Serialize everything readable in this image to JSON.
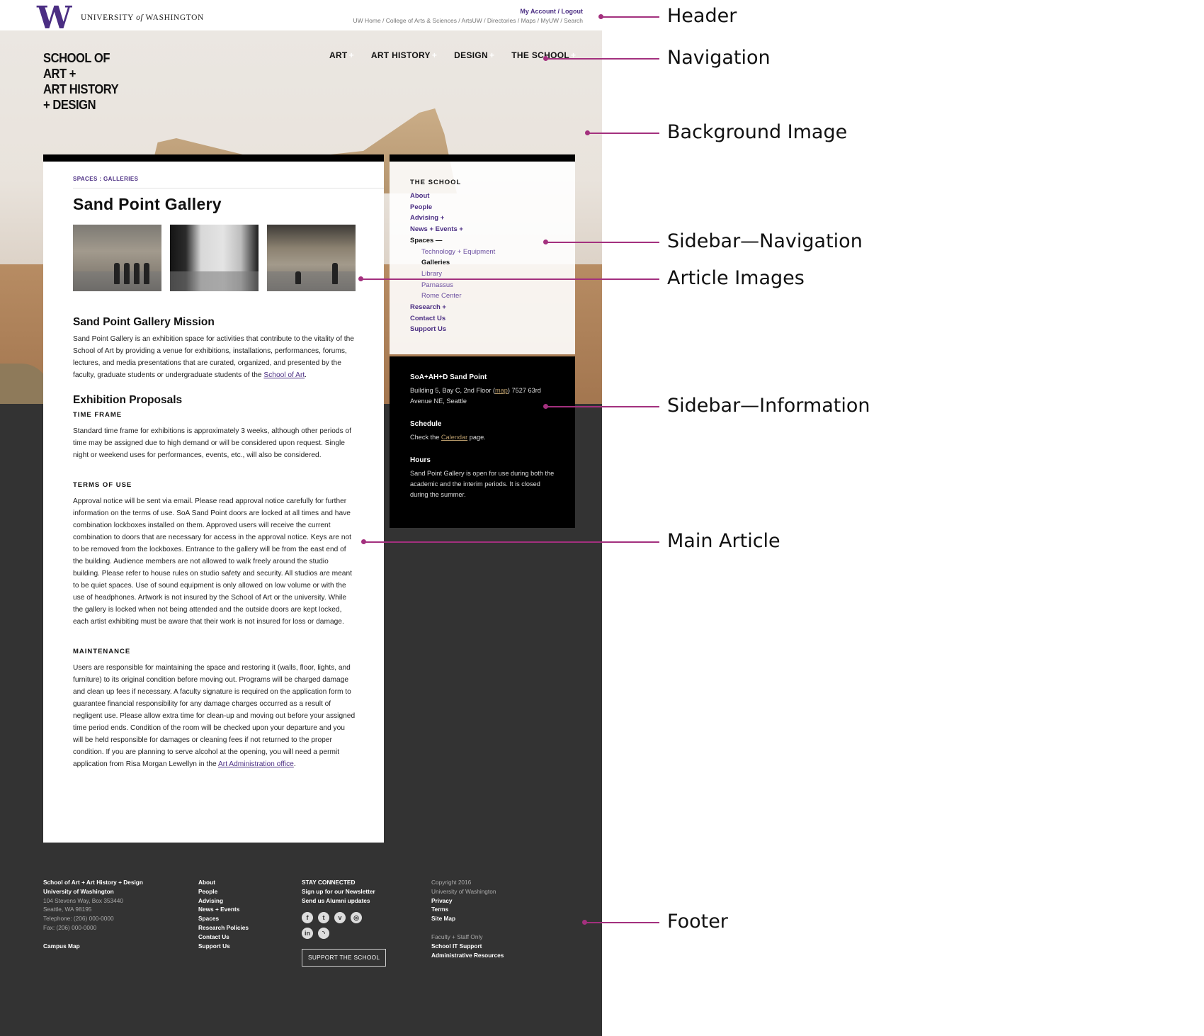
{
  "header": {
    "uw_name": "UNIVERSITY",
    "uw_of": "of",
    "uw_name_end": "WASHINGTON",
    "account": "My Account / Logout",
    "util_links": "UW Home / College of Arts & Sciences / ArtsUW / Directories / Maps / MyUW / Search"
  },
  "logo": {
    "lines": [
      "SCHOOL OF",
      "ART +",
      "ART HISTORY",
      "+ DESIGN"
    ]
  },
  "nav": {
    "items": [
      "ART",
      "ART HISTORY",
      "DESIGN",
      "THE SCHOOL"
    ],
    "plus": "+"
  },
  "article": {
    "breadcrumb": "SPACES : GALLERIES",
    "title": "Sand Point Gallery",
    "mission_heading": "Sand Point Gallery Mission",
    "mission_text": "Sand Point Gallery is an exhibition space for activities that contribute to the vitality of the School of Art by providing a venue for exhibitions, installations, performances, forums, lectures, and media presentations that are curated, organized, and presented by the faculty, graduate students or undergraduate students of the ",
    "mission_link": "School of Art",
    "proposals_heading": "Exhibition Proposals",
    "timeframe_heading": "TIME FRAME",
    "timeframe_text": "Standard time frame for exhibitions is approximately 3 weeks, although other periods of time may be assigned due to high demand or will be considered upon request. Single night or weekend uses for performances, events, etc., will also be considered.",
    "terms_heading": "TERMS OF USE",
    "terms_text": "Approval notice will be sent via email. Please read approval notice carefully for further information on the terms of use. SoA Sand Point doors are locked at all times and have combination lockboxes installed on them. Approved users will receive the current combination to doors that are necessary for access in the approval notice. Keys are not to be removed from the lockboxes. Entrance to the gallery will be from the east end of the building. Audience members are not allowed to walk freely around the studio building. Please refer to house rules on studio safety and security. All studios are meant to be quiet spaces. Use of sound equipment is only allowed on low volume or with the use of headphones. Artwork is not insured by the School of Art or the university. While the gallery is locked when not being attended and the outside doors are kept locked, each artist exhibiting must be aware that their work is not insured for loss or damage.",
    "maintenance_heading": "MAINTENANCE",
    "maintenance_text": "Users are responsible for maintaining the space and restoring it (walls, floor, lights, and furniture) to its original condition before moving out. Programs will be charged damage and clean up fees if necessary. A faculty signature is required on the application form to guarantee financial responsibility for any damage charges occurred as a result of negligent use. Please allow extra time for clean-up and moving out before your assigned time period ends. Condition of the room will be checked upon your departure and you will be held responsible for damages or cleaning fees if not returned to the proper condition. If you are planning to serve alcohol at the opening, you will need a permit application from Risa Morgan Lewellyn in the ",
    "maintenance_link": "Art Administration office"
  },
  "sidebar_nav": {
    "heading": "THE SCHOOL",
    "about": "About",
    "people": "People",
    "advising": "Advising +",
    "news": "News + Events +",
    "spaces": "Spaces —",
    "tech": "Technology + Equipment",
    "galleries": "Galleries",
    "library": "Library",
    "parnassus": "Parnassus",
    "rome": "Rome Center",
    "research": "Research +",
    "contact": "Contact Us",
    "support": "Support Us"
  },
  "sidebar_info": {
    "location_heading": "SoA+AH+D Sand Point",
    "location_pre": "Building 5, Bay C, 2nd Floor (",
    "location_link": "map",
    "location_post": ") 7527 63rd Avenue NE, Seattle",
    "schedule_heading": "Schedule",
    "schedule_pre": "Check the ",
    "schedule_link": "Calendar",
    "schedule_post": " page.",
    "hours_heading": "Hours",
    "hours_text": "Sand Point Gallery is open for use during both the academic and the interim periods. It is closed during the summer."
  },
  "footer": {
    "col1": {
      "school": "School of Art + Art History + Design",
      "uw": "University of Washington",
      "address1": "104 Stevens Way, Box 353440",
      "address2": "Seattle, WA 98195",
      "phone": "Telephone: (206) 000-0000",
      "fax": "Fax: (206) 000-0000",
      "campus_map": "Campus Map"
    },
    "col2": [
      "About",
      "People",
      "Advising",
      "News + Events",
      "Spaces",
      "Research Policies",
      "Contact Us",
      "Support Us"
    ],
    "col3": {
      "heading": "STAY CONNECTED",
      "newsletter": "Sign up for our Newsletter",
      "alumni": "Send us Alumni updates",
      "support_button": "SUPPORT THE SCHOOL",
      "social_icons": [
        "facebook-icon",
        "twitter-icon",
        "vimeo-icon",
        "instagram-icon",
        "linkedin-icon",
        "rss-icon"
      ]
    },
    "col4": {
      "copyright": "Copyright 2016",
      "uw": "University of Washington",
      "privacy": "Privacy",
      "terms": "Terms",
      "sitemap": "Site Map",
      "faculty": "Faculty + Staff Only",
      "it": "School IT Support",
      "admin": "Administrative Resources"
    }
  },
  "annotations": [
    "Header",
    "Navigation",
    "Background Image",
    "Sidebar—Navigation",
    "Article Images",
    "Sidebar—Information",
    "Main Article",
    "Footer"
  ],
  "colors": {
    "uw_purple": "#4b2e83",
    "annotation": "#a3307e",
    "footer_bg": "#333333",
    "gold_link": "#b79a6a"
  }
}
